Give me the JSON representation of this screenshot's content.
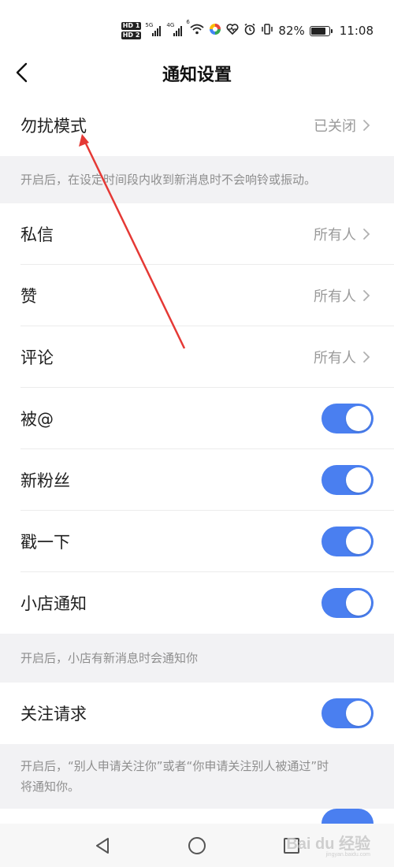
{
  "status_bar": {
    "hd1": "HD 1",
    "hd2": "HD 2",
    "net1": "5G",
    "net2": "4G",
    "wifi_label": "6",
    "battery_percent": "82%",
    "battery_level": 0.82,
    "time": "11:08"
  },
  "header": {
    "title": "通知设置"
  },
  "dnd": {
    "label": "勿扰模式",
    "value": "已关闭"
  },
  "dnd_note": "开启后，在设定时间段内收到新消息时不会响铃或振动。",
  "items": [
    {
      "label": "私信",
      "value": "所有人"
    },
    {
      "label": "赞",
      "value": "所有人"
    },
    {
      "label": "评论",
      "value": "所有人"
    }
  ],
  "toggles": [
    {
      "label": "被@",
      "on": true
    },
    {
      "label": "新粉丝",
      "on": true
    },
    {
      "label": "戳一下",
      "on": true
    },
    {
      "label": "小店通知",
      "on": true
    }
  ],
  "shop_note": "开启后，小店有新消息时会通知你",
  "follow": {
    "label": "关注请求",
    "on": true
  },
  "follow_note_line1": "开启后，“别人申请关注你”或者“你申请关注别人被通过”时",
  "follow_note_line2": "将通知你。",
  "colors": {
    "accent": "#4a7ff0",
    "annotation_arrow": "#e53935"
  },
  "watermark": {
    "text": "Bai du 经验",
    "sub": "jingyan.baidu.com"
  }
}
